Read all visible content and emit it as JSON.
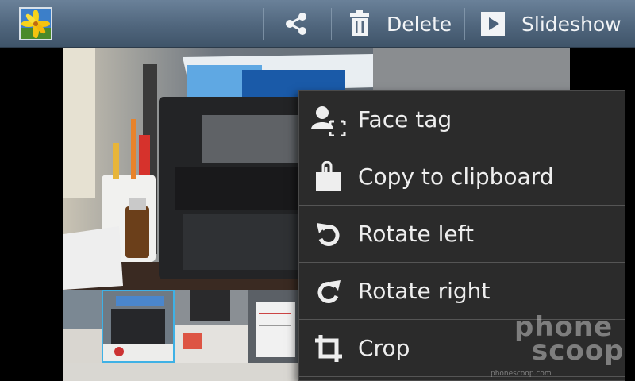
{
  "actionbar": {
    "share_icon": "share-icon",
    "delete_label": "Delete",
    "slideshow_label": "Slideshow"
  },
  "menu": {
    "items": [
      {
        "label": "Face tag",
        "icon": "face-tag-icon"
      },
      {
        "label": "Copy to clipboard",
        "icon": "clipboard-icon"
      },
      {
        "label": "Rotate left",
        "icon": "rotate-left-icon"
      },
      {
        "label": "Rotate right",
        "icon": "rotate-right-icon"
      },
      {
        "label": "Crop",
        "icon": "crop-icon"
      }
    ]
  },
  "watermark": {
    "line1": "phone",
    "line2": "scoop",
    "url": "phonescoop.com"
  },
  "colors": {
    "actionbar": "#50667d",
    "menu_bg": "#2b2b2b",
    "selection": "#3fb1e5"
  }
}
